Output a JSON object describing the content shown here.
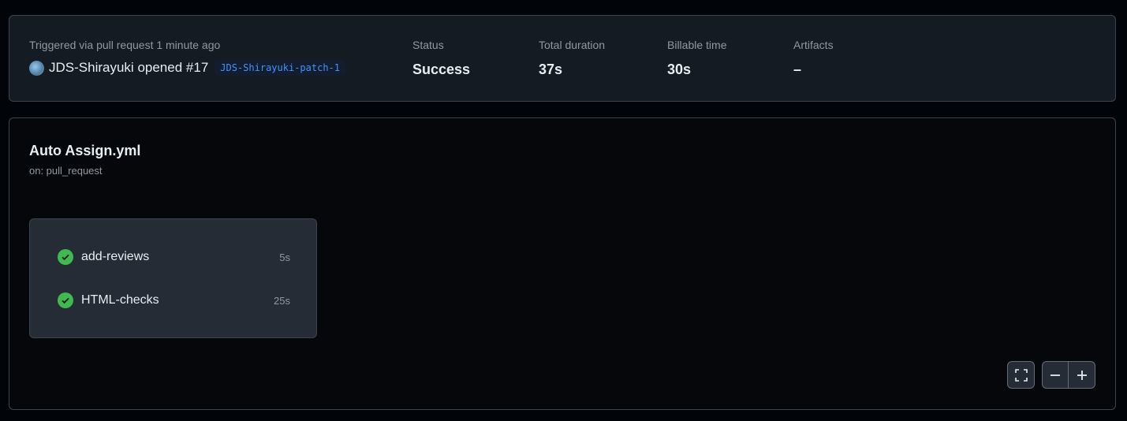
{
  "summary": {
    "trigger_label": "Triggered via pull request 1 minute ago",
    "actor": "JDS-Shirayuki",
    "action": "opened",
    "pr_number": "#17",
    "branch": "JDS-Shirayuki-patch-1",
    "status_label": "Status",
    "status_value": "Success",
    "duration_label": "Total duration",
    "duration_value": "37s",
    "billable_label": "Billable time",
    "billable_value": "30s",
    "artifacts_label": "Artifacts",
    "artifacts_value": "–"
  },
  "workflow": {
    "title": "Auto Assign.yml",
    "trigger": "on: pull_request",
    "jobs": [
      {
        "name": "add-reviews",
        "duration": "5s",
        "status": "success"
      },
      {
        "name": "HTML-checks",
        "duration": "25s",
        "status": "success"
      }
    ]
  },
  "colors": {
    "success": "#3fb950",
    "link": "#4493f8"
  }
}
